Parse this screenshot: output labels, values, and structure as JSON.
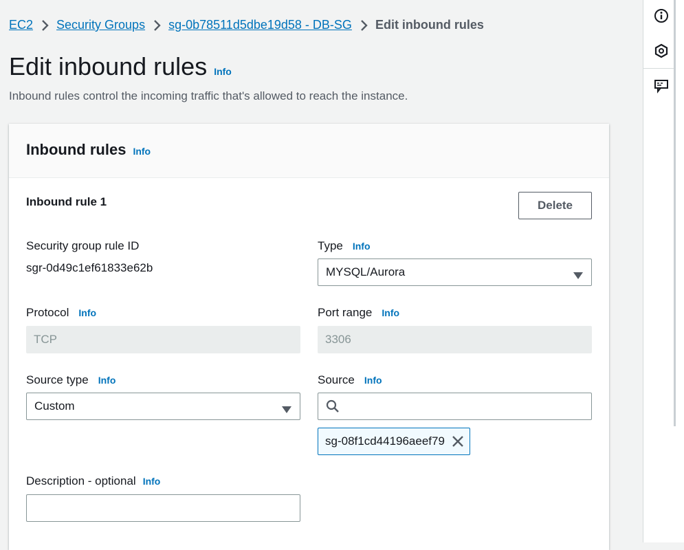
{
  "breadcrumb": {
    "items": [
      "EC2",
      "Security Groups",
      "sg-0b78511d5dbe19d58 - DB-SG"
    ],
    "current": "Edit inbound rules"
  },
  "page": {
    "title": "Edit inbound rules",
    "info": "Info",
    "description": "Inbound rules control the incoming traffic that's allowed to reach the instance."
  },
  "card": {
    "title": "Inbound rules",
    "info": "Info"
  },
  "rule": {
    "title": "Inbound rule 1",
    "delete_label": "Delete",
    "sg_rule_id_label": "Security group rule ID",
    "sg_rule_id_value": "sgr-0d49c1ef61833e62b",
    "type_label": "Type",
    "type_info": "Info",
    "type_value": "MYSQL/Aurora",
    "protocol_label": "Protocol",
    "protocol_info": "Info",
    "protocol_value": "TCP",
    "port_range_label": "Port range",
    "port_range_info": "Info",
    "port_range_value": "3306",
    "source_type_label": "Source type",
    "source_type_info": "Info",
    "source_type_value": "Custom",
    "source_label": "Source",
    "source_info": "Info",
    "source_search_value": "",
    "source_token": "sg-08f1cd44196aeef79",
    "description_label": "Description - optional",
    "description_info": "Info",
    "description_value": ""
  },
  "rightbar": {
    "icons": [
      "info-circle-icon",
      "hexagon-settings-icon",
      "feedback-icon"
    ]
  },
  "colors": {
    "link": "#0073bb",
    "background": "#f2f3f3",
    "text": "#16191f",
    "muted": "#545b64"
  }
}
